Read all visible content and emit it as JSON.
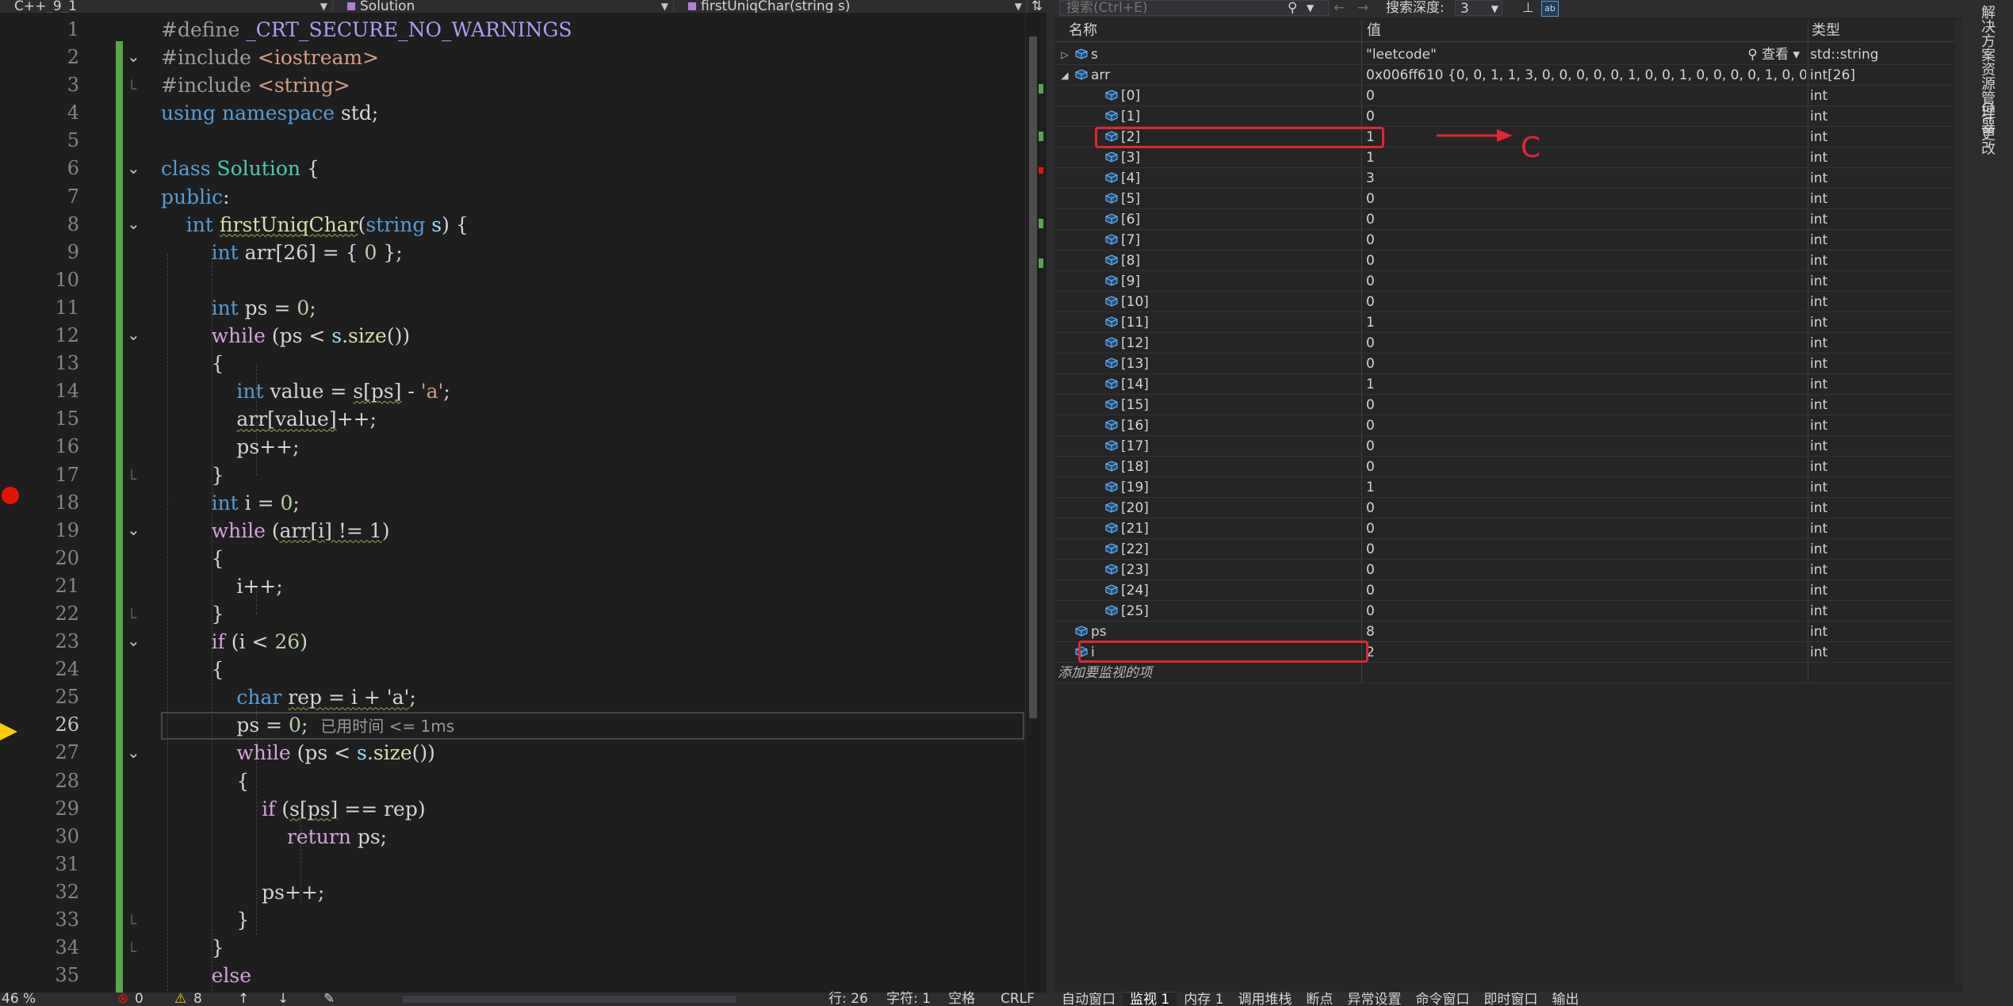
{
  "editor": {
    "nav": {
      "project": "C++_9_1",
      "scope": "Solution",
      "member": "firstUniqChar(string s)"
    },
    "inline_hint": "已用时间 <= 1ms",
    "status": {
      "zoom": "46 %",
      "errors": "0",
      "warnings": "8",
      "position": "行: 26",
      "char": "字符: 1",
      "indent": "空格",
      "eol": "CRLF"
    }
  },
  "code": {
    "line_numbers": [
      "1",
      "2",
      "3",
      "4",
      "5",
      "6",
      "7",
      "8",
      "9",
      "10",
      "11",
      "12",
      "13",
      "14",
      "15",
      "16",
      "17",
      "18",
      "19",
      "20",
      "21",
      "22",
      "23",
      "24",
      "25",
      "26",
      "27",
      "28",
      "29",
      "30",
      "31",
      "32",
      "33",
      "34",
      "35"
    ],
    "current_line": 26,
    "breakpoint_line": 18,
    "lines": [
      [
        [
          "pp",
          "#define "
        ],
        [
          "mac",
          "_CRT_SECURE_NO_WARNINGS"
        ]
      ],
      [
        [
          "pp",
          "#include "
        ],
        [
          "str",
          "<iostream>"
        ]
      ],
      [
        [
          "pp",
          "#include "
        ],
        [
          "str",
          "<string>"
        ]
      ],
      [
        [
          "kw",
          "using namespace "
        ],
        [
          "pl",
          "std;"
        ]
      ],
      [],
      [
        [
          "kw",
          "class "
        ],
        [
          "typ",
          "Solution "
        ],
        [
          "pl",
          "{"
        ]
      ],
      [
        [
          "kw",
          "public"
        ],
        [
          "pl",
          ":"
        ]
      ],
      [
        [
          "pl",
          "    "
        ],
        [
          "kw",
          "int "
        ],
        [
          "fnsq",
          "firstUniqChar"
        ],
        [
          "pl",
          "("
        ],
        [
          "kw",
          "string "
        ],
        [
          "var",
          "s"
        ],
        [
          "pl",
          ") {"
        ]
      ],
      [
        [
          "pl",
          "        "
        ],
        [
          "kw",
          "int "
        ],
        [
          "pl",
          "arr[26] = { "
        ],
        [
          "num",
          "0"
        ],
        [
          "pl",
          " };"
        ]
      ],
      [],
      [
        [
          "pl",
          "        "
        ],
        [
          "kw",
          "int "
        ],
        [
          "pl",
          "ps = "
        ],
        [
          "num",
          "0"
        ],
        [
          "pl",
          ";"
        ]
      ],
      [
        [
          "pl",
          "        "
        ],
        [
          "ctl",
          "while "
        ],
        [
          "pl",
          "(ps < "
        ],
        [
          "var",
          "s"
        ],
        [
          "pl",
          "."
        ],
        [
          "fn",
          "size"
        ],
        [
          "pl",
          "())"
        ]
      ],
      [
        [
          "pl",
          "        {"
        ]
      ],
      [
        [
          "pl",
          "            "
        ],
        [
          "kw",
          "int "
        ],
        [
          "pl",
          "value = "
        ],
        [
          "sq",
          "s[ps]"
        ],
        [
          "pl",
          " - "
        ],
        [
          "str",
          "'a'"
        ],
        [
          "pl",
          ";"
        ]
      ],
      [
        [
          "pl",
          "            "
        ],
        [
          "sq",
          "arr[value]"
        ],
        [
          "pl",
          "++;"
        ]
      ],
      [
        [
          "pl",
          "            ps++;"
        ]
      ],
      [
        [
          "pl",
          "        }"
        ]
      ],
      [
        [
          "pl",
          "        "
        ],
        [
          "kw",
          "int "
        ],
        [
          "pl",
          "i = "
        ],
        [
          "num",
          "0"
        ],
        [
          "pl",
          ";"
        ]
      ],
      [
        [
          "pl",
          "        "
        ],
        [
          "ctl",
          "while "
        ],
        [
          "pl",
          "("
        ],
        [
          "sq",
          "arr[i] != 1"
        ],
        [
          "pl",
          ")"
        ]
      ],
      [
        [
          "pl",
          "        {"
        ]
      ],
      [
        [
          "pl",
          "            i++;"
        ]
      ],
      [
        [
          "pl",
          "        }"
        ]
      ],
      [
        [
          "pl",
          "        "
        ],
        [
          "ctl",
          "if "
        ],
        [
          "pl",
          "(i < "
        ],
        [
          "num",
          "26"
        ],
        [
          "pl",
          ")"
        ]
      ],
      [
        [
          "pl",
          "        {"
        ]
      ],
      [
        [
          "pl",
          "            "
        ],
        [
          "kw",
          "char "
        ],
        [
          "sq",
          "rep = i + 'a'"
        ],
        [
          "pl",
          ";"
        ]
      ],
      [
        [
          "pl",
          "            ps = "
        ],
        [
          "num",
          "0"
        ],
        [
          "pl",
          ";  "
        ],
        [
          "hint",
          "已用时间 <= 1ms"
        ]
      ],
      [
        [
          "pl",
          "            "
        ],
        [
          "ctl",
          "while "
        ],
        [
          "pl",
          "(ps < "
        ],
        [
          "var",
          "s"
        ],
        [
          "pl",
          "."
        ],
        [
          "fn",
          "size"
        ],
        [
          "pl",
          "())"
        ]
      ],
      [
        [
          "pl",
          "            {"
        ]
      ],
      [
        [
          "pl",
          "                "
        ],
        [
          "ctl",
          "if "
        ],
        [
          "pl",
          "("
        ],
        [
          "sq",
          "s[ps]"
        ],
        [
          "pl",
          " == rep)"
        ]
      ],
      [
        [
          "pl",
          "                    "
        ],
        [
          "ctl",
          "return "
        ],
        [
          "pl",
          "ps;"
        ]
      ],
      [],
      [
        [
          "pl",
          "                ps++;"
        ]
      ],
      [
        [
          "pl",
          "            }"
        ]
      ],
      [
        [
          "pl",
          "        }"
        ]
      ],
      [
        [
          "pl",
          "        "
        ],
        [
          "ctl",
          "else"
        ]
      ]
    ]
  },
  "watch": {
    "toolbar": {
      "search_placeholder": "搜索(Ctrl+E)",
      "depth_label": "搜索深度:",
      "depth_value": "3"
    },
    "columns": {
      "name": "名称",
      "value": "值",
      "type": "类型"
    },
    "view_label": "查看",
    "rows": [
      {
        "name": "s",
        "value": "\"leetcode\"",
        "type": "std::string",
        "level": 0,
        "expander": "collapsed",
        "view": true
      },
      {
        "name": "arr",
        "value": "0x006ff610 {0, 0, 1, 1, 3, 0, 0, 0, 0, 0, 1, 0, 0, 1, 0, 0, 0, 0, 1, 0, 0, 0, ...",
        "type": "int[26]",
        "level": 0,
        "expander": "expanded"
      },
      {
        "name": "[0]",
        "value": "0",
        "type": "int",
        "level": 1
      },
      {
        "name": "[1]",
        "value": "0",
        "type": "int",
        "level": 1
      },
      {
        "name": "[2]",
        "value": "1",
        "type": "int",
        "level": 1,
        "highlight": true
      },
      {
        "name": "[3]",
        "value": "1",
        "type": "int",
        "level": 1
      },
      {
        "name": "[4]",
        "value": "3",
        "type": "int",
        "level": 1
      },
      {
        "name": "[5]",
        "value": "0",
        "type": "int",
        "level": 1
      },
      {
        "name": "[6]",
        "value": "0",
        "type": "int",
        "level": 1
      },
      {
        "name": "[7]",
        "value": "0",
        "type": "int",
        "level": 1
      },
      {
        "name": "[8]",
        "value": "0",
        "type": "int",
        "level": 1
      },
      {
        "name": "[9]",
        "value": "0",
        "type": "int",
        "level": 1
      },
      {
        "name": "[10]",
        "value": "0",
        "type": "int",
        "level": 1
      },
      {
        "name": "[11]",
        "value": "1",
        "type": "int",
        "level": 1
      },
      {
        "name": "[12]",
        "value": "0",
        "type": "int",
        "level": 1
      },
      {
        "name": "[13]",
        "value": "0",
        "type": "int",
        "level": 1
      },
      {
        "name": "[14]",
        "value": "1",
        "type": "int",
        "level": 1
      },
      {
        "name": "[15]",
        "value": "0",
        "type": "int",
        "level": 1
      },
      {
        "name": "[16]",
        "value": "0",
        "type": "int",
        "level": 1
      },
      {
        "name": "[17]",
        "value": "0",
        "type": "int",
        "level": 1
      },
      {
        "name": "[18]",
        "value": "0",
        "type": "int",
        "level": 1
      },
      {
        "name": "[19]",
        "value": "1",
        "type": "int",
        "level": 1
      },
      {
        "name": "[20]",
        "value": "0",
        "type": "int",
        "level": 1
      },
      {
        "name": "[21]",
        "value": "0",
        "type": "int",
        "level": 1
      },
      {
        "name": "[22]",
        "value": "0",
        "type": "int",
        "level": 1
      },
      {
        "name": "[23]",
        "value": "0",
        "type": "int",
        "level": 1
      },
      {
        "name": "[24]",
        "value": "0",
        "type": "int",
        "level": 1
      },
      {
        "name": "[25]",
        "value": "0",
        "type": "int",
        "level": 1
      },
      {
        "name": "ps",
        "value": "8",
        "type": "int",
        "level": 0
      },
      {
        "name": "i",
        "value": "2",
        "type": "int",
        "level": 0,
        "highlight": true
      },
      {
        "name": "添加要监视的项",
        "value": "",
        "type": "",
        "level": 0,
        "placeholder": true
      }
    ],
    "annotation_label": "C",
    "tabs": [
      "自动窗口",
      "监视 1",
      "内存 1",
      "调用堆栈",
      "断点",
      "异常设置",
      "命令窗口",
      "即时窗口",
      "输出"
    ],
    "active_tab": "监视 1"
  },
  "rail": {
    "tabs": [
      "解决方案资源管理器",
      "Git 更改"
    ]
  },
  "colors": {
    "breakpoint": "#e51400",
    "instruction_pointer": "#ffcc00",
    "annotation": "#e0282e",
    "change_bar": "#57a64a"
  }
}
